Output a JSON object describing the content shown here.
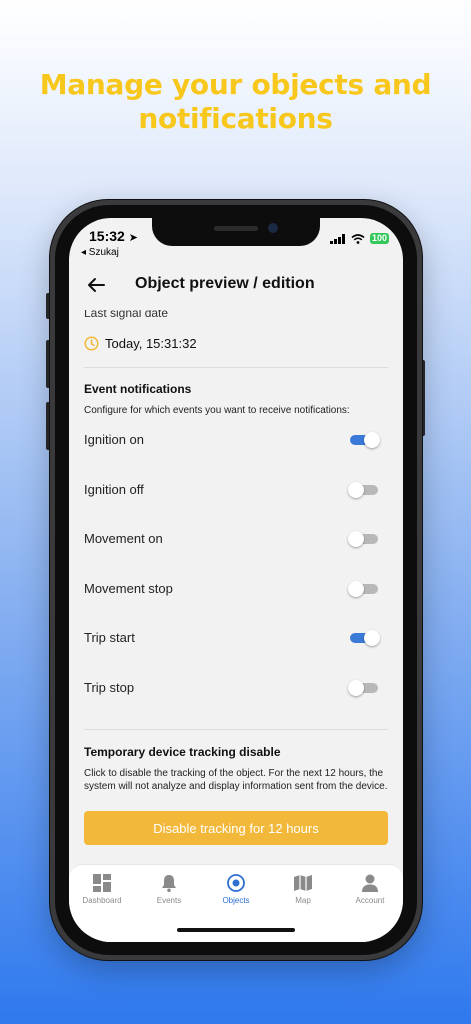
{
  "headline": "Manage your objects and notifications",
  "status_bar": {
    "time": "15:32",
    "back_app": "◂ Szukaj",
    "battery": "100"
  },
  "header": {
    "title": "Object preview / edition"
  },
  "last_signal": {
    "label": "Last signal date",
    "value": "Today, 15:31:32"
  },
  "event_notifications": {
    "title": "Event notifications",
    "description": "Configure for which events you want to receive notifications:",
    "items": [
      {
        "label": "Ignition on",
        "enabled": true
      },
      {
        "label": "Ignition off",
        "enabled": false
      },
      {
        "label": "Movement on",
        "enabled": false
      },
      {
        "label": "Movement stop",
        "enabled": false
      },
      {
        "label": "Trip start",
        "enabled": true
      },
      {
        "label": "Trip stop",
        "enabled": false
      }
    ]
  },
  "tracking_disable": {
    "title": "Temporary device tracking disable",
    "description": "Click to disable the tracking of the object. For the next 12 hours, the system will not analyze and display information sent from the device.",
    "button_label": "Disable tracking for 12 hours"
  },
  "tabbar": {
    "tabs": [
      {
        "label": "Dashboard",
        "icon": "dashboard-icon",
        "active": false
      },
      {
        "label": "Events",
        "icon": "bell-icon",
        "active": false
      },
      {
        "label": "Objects",
        "icon": "target-icon",
        "active": true
      },
      {
        "label": "Map",
        "icon": "map-icon",
        "active": false
      },
      {
        "label": "Account",
        "icon": "user-icon",
        "active": false
      }
    ]
  },
  "colors": {
    "headline": "#f7c71c",
    "toggle_on": "#3b79d6",
    "button": "#f2b83a",
    "active_tab": "#2f6fd0"
  }
}
